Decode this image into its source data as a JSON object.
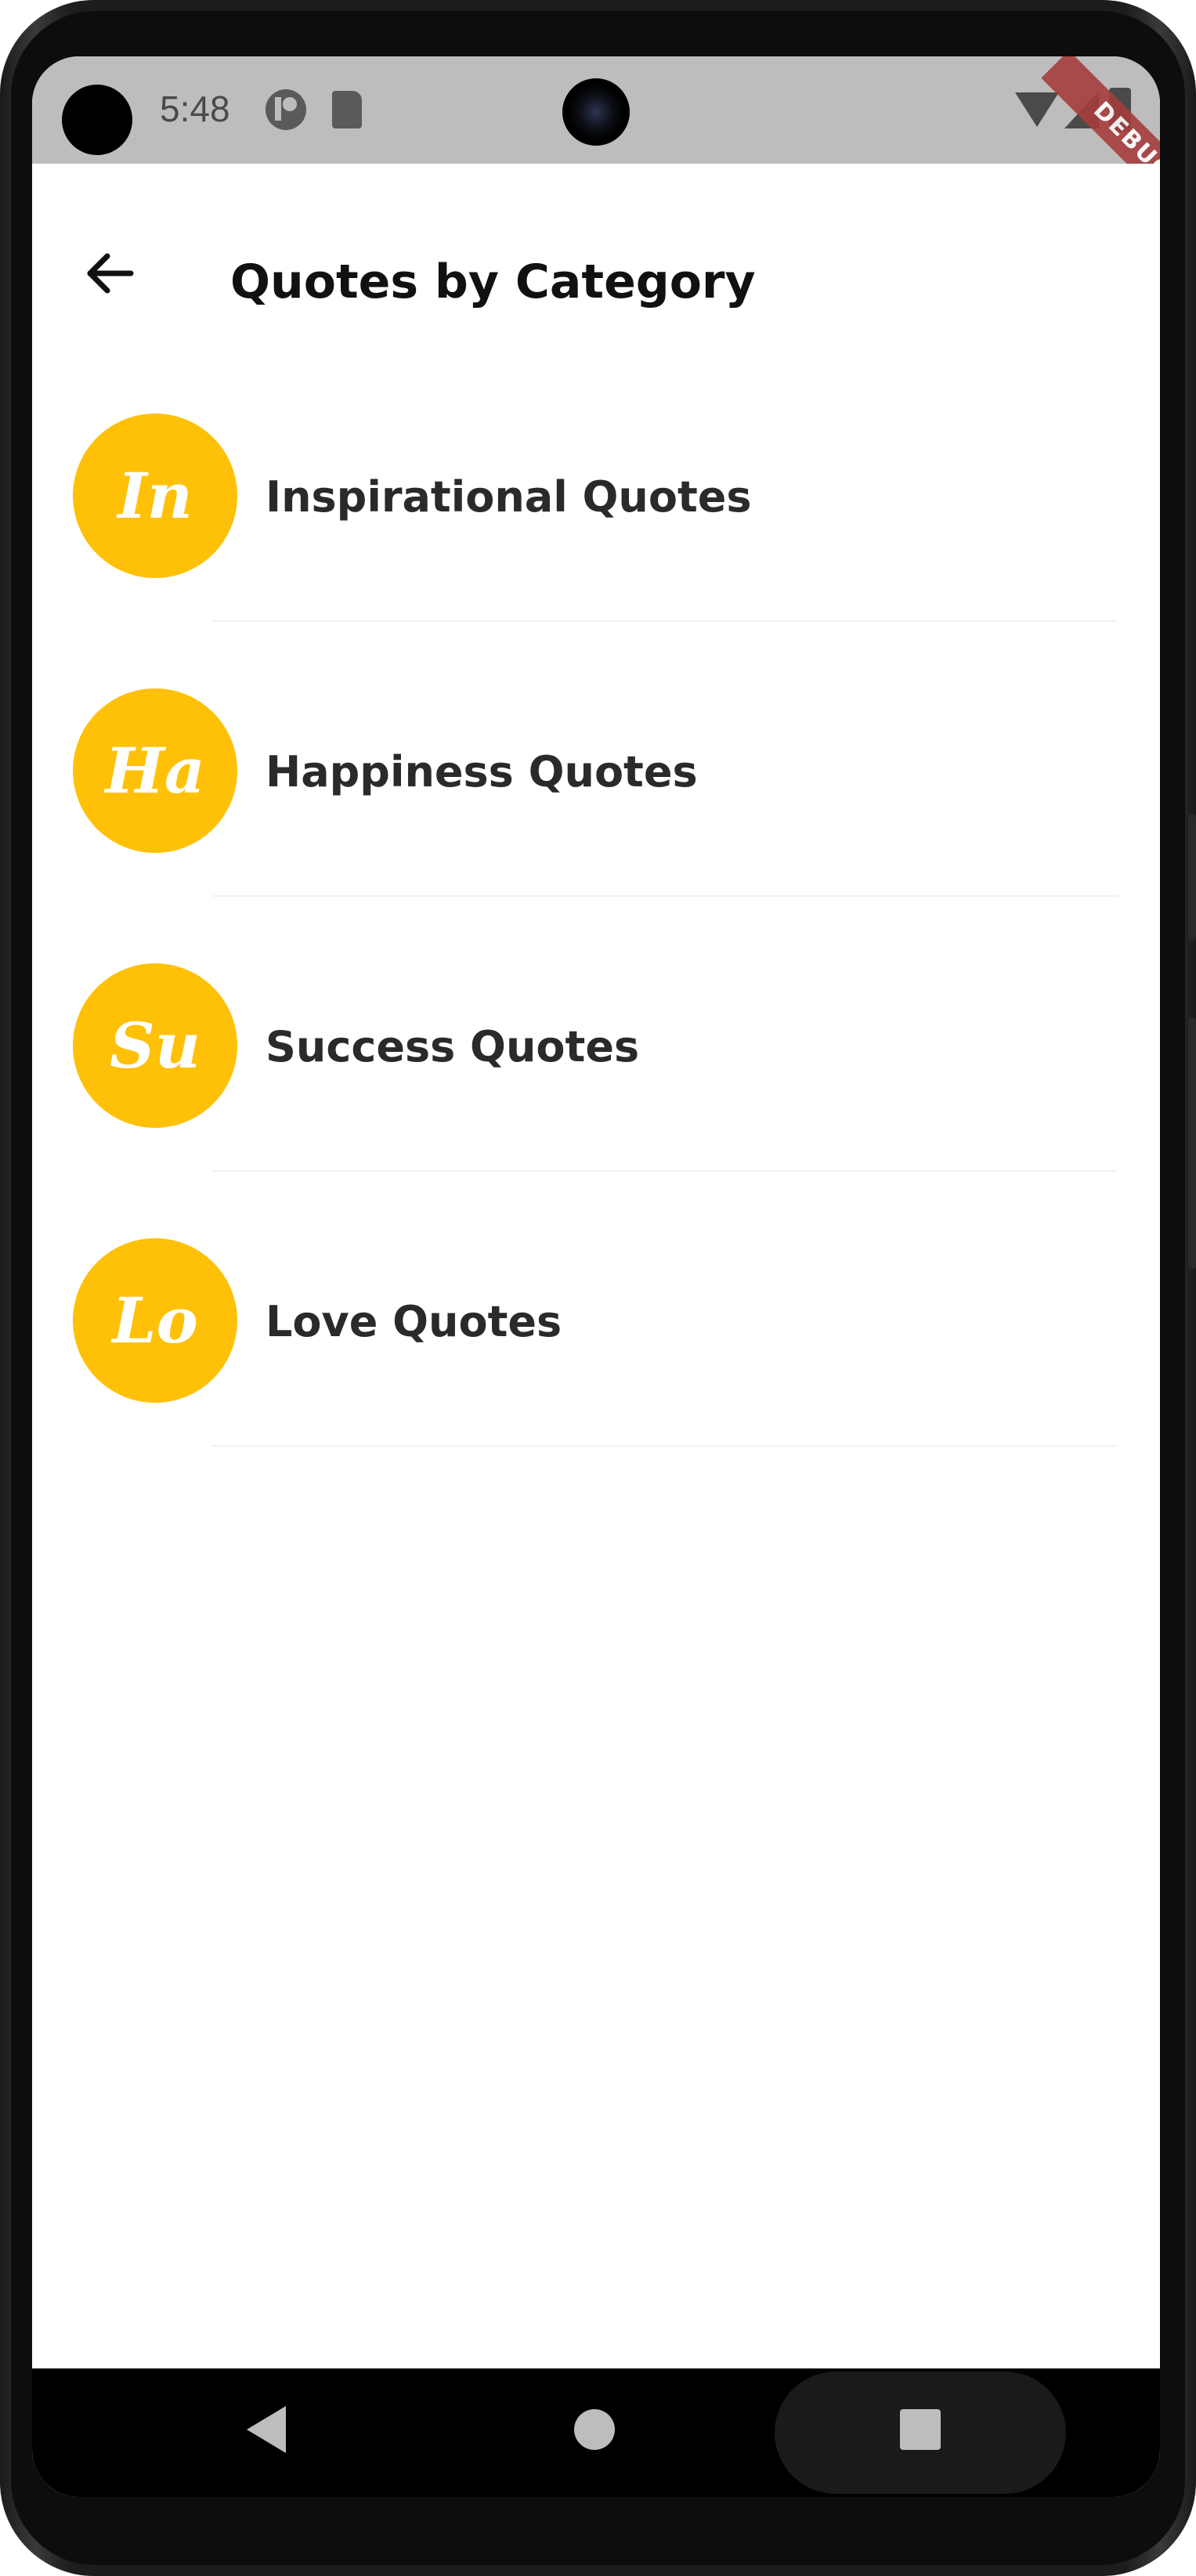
{
  "status_bar": {
    "time": "5:48"
  },
  "debug_banner": "DEBUG",
  "app_bar": {
    "title": "Quotes by Category",
    "back_icon": "arrow-back-icon"
  },
  "categories": [
    {
      "initials": "In",
      "label": "Inspirational Quotes"
    },
    {
      "initials": "Ha",
      "label": "Happiness Quotes"
    },
    {
      "initials": "Su",
      "label": "Success Quotes"
    },
    {
      "initials": "Lo",
      "label": "Love Quotes"
    }
  ],
  "colors": {
    "avatar_background": "#ffc107",
    "avatar_text": "#ffffff",
    "status_bar": "#bdbdbd",
    "debug_ribbon": "#a63d3d"
  },
  "navigation": {
    "back_icon": "nav-back-icon",
    "home_icon": "nav-home-icon",
    "recents_icon": "nav-recents-icon"
  }
}
